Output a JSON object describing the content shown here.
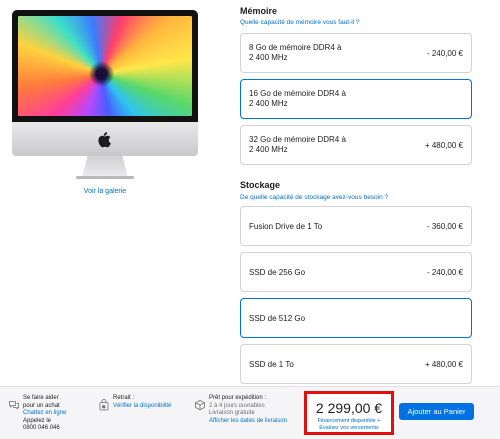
{
  "gallery_link": "Voir la galerie",
  "memory": {
    "title": "Mémoire",
    "help": "Quelle capacité de mémoire vous faut-il ?",
    "options": [
      {
        "label_line1": "8 Go de mémoire DDR4 à",
        "label_line2": "2 400 MHz",
        "price": "- 240,00 €",
        "selected": false
      },
      {
        "label_line1": "16 Go de mémoire DDR4 à",
        "label_line2": "2 400 MHz",
        "price": "",
        "selected": true
      },
      {
        "label_line1": "32 Go de mémoire DDR4 à",
        "label_line2": "2 400 MHz",
        "price": "+ 480,00 €",
        "selected": false
      }
    ]
  },
  "storage": {
    "title": "Stockage",
    "help": "De quelle capacité de stockage avez-vous besoin ?",
    "options": [
      {
        "label": "Fusion Drive de 1 To",
        "price": "- 360,00 €",
        "selected": false
      },
      {
        "label": "SSD de 256 Go",
        "price": "- 240,00 €",
        "selected": false
      },
      {
        "label": "SSD de 512 Go",
        "price": "",
        "selected": true
      },
      {
        "label": "SSD de 1 To",
        "price": "+ 480,00 €",
        "selected": false
      }
    ]
  },
  "footer": {
    "help": {
      "line1": "Se faire aider",
      "line2": "pour un achat",
      "chat": "Chattez en ligne",
      "call": "Appelez le",
      "phone": "0800 046 046"
    },
    "pickup": {
      "line1": "Retrait :",
      "link": "Vérifier la disponibilité"
    },
    "shipping": {
      "line1": "Prêt pour expédition :",
      "line2": "2 à 4 jours ouvrables",
      "line3": "Livraison gratuite",
      "link": "Afficher les dates de livraison"
    },
    "price": "2 299,00 €",
    "financing": "Financement disponible",
    "payments": "Évaluez vos versements",
    "cart_button": "Ajouter au Panier"
  },
  "colors": {
    "accent": "#0071e3",
    "link": "#0070c9",
    "highlight": "#e01010"
  }
}
